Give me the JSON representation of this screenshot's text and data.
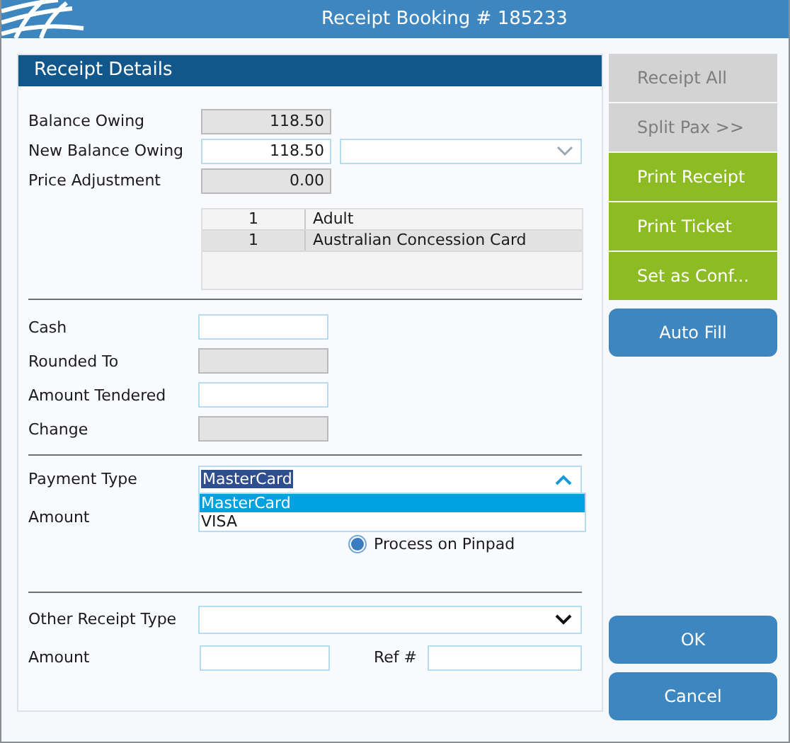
{
  "window": {
    "title": "Receipt Booking # 185233"
  },
  "panel": {
    "title": "Receipt Details"
  },
  "balance_fields": [
    {
      "kind": "field",
      "label": "Balance Owing",
      "value": "118.50",
      "disabled": true
    },
    {
      "kind": "field_with_dropdown",
      "label": "New Balance Owing",
      "value": "118.50",
      "disabled": false
    },
    {
      "kind": "field",
      "label": "Price Adjustment",
      "value": "0.00",
      "disabled": true
    }
  ],
  "pax_table": {
    "rows": [
      {
        "count": "1",
        "type": "Adult",
        "selected": false
      },
      {
        "count": "1",
        "type": "Australian Concession Card",
        "selected": true
      }
    ]
  },
  "cash_fields": [
    {
      "label": "Cash",
      "disabled": false
    },
    {
      "label": "Rounded To",
      "disabled": true
    },
    {
      "label": "Amount Tendered",
      "disabled": false
    },
    {
      "label": "Change",
      "disabled": true
    }
  ],
  "payment": {
    "label": "Payment Type",
    "value": "MasterCard",
    "expanded": true,
    "options": [
      {
        "label": "MasterCard",
        "selected": true
      },
      {
        "label": "VISA",
        "selected": false
      }
    ],
    "amount_label": "Amount",
    "radio": {
      "label": "Process on Pinpad",
      "checked": true
    }
  },
  "other_receipt": {
    "label": "Other Receipt Type",
    "expanded": false,
    "amount_label": "Amount",
    "ref_label": "Ref #"
  },
  "actions": [
    {
      "kind": "tile",
      "label": "Receipt All",
      "disabled": true
    },
    {
      "kind": "tile",
      "label": "Split Pax >>",
      "disabled": true
    },
    {
      "kind": "tile",
      "label": "Print Receipt",
      "disabled": false
    },
    {
      "kind": "tile",
      "label": "Print Ticket",
      "disabled": false
    },
    {
      "kind": "tile",
      "label": "Set as Conf...",
      "disabled": false
    },
    {
      "kind": "rounded",
      "label": "Auto Fill",
      "disabled": false
    }
  ],
  "dialog_buttons": [
    {
      "label": "OK"
    },
    {
      "label": "Cancel"
    }
  ]
}
